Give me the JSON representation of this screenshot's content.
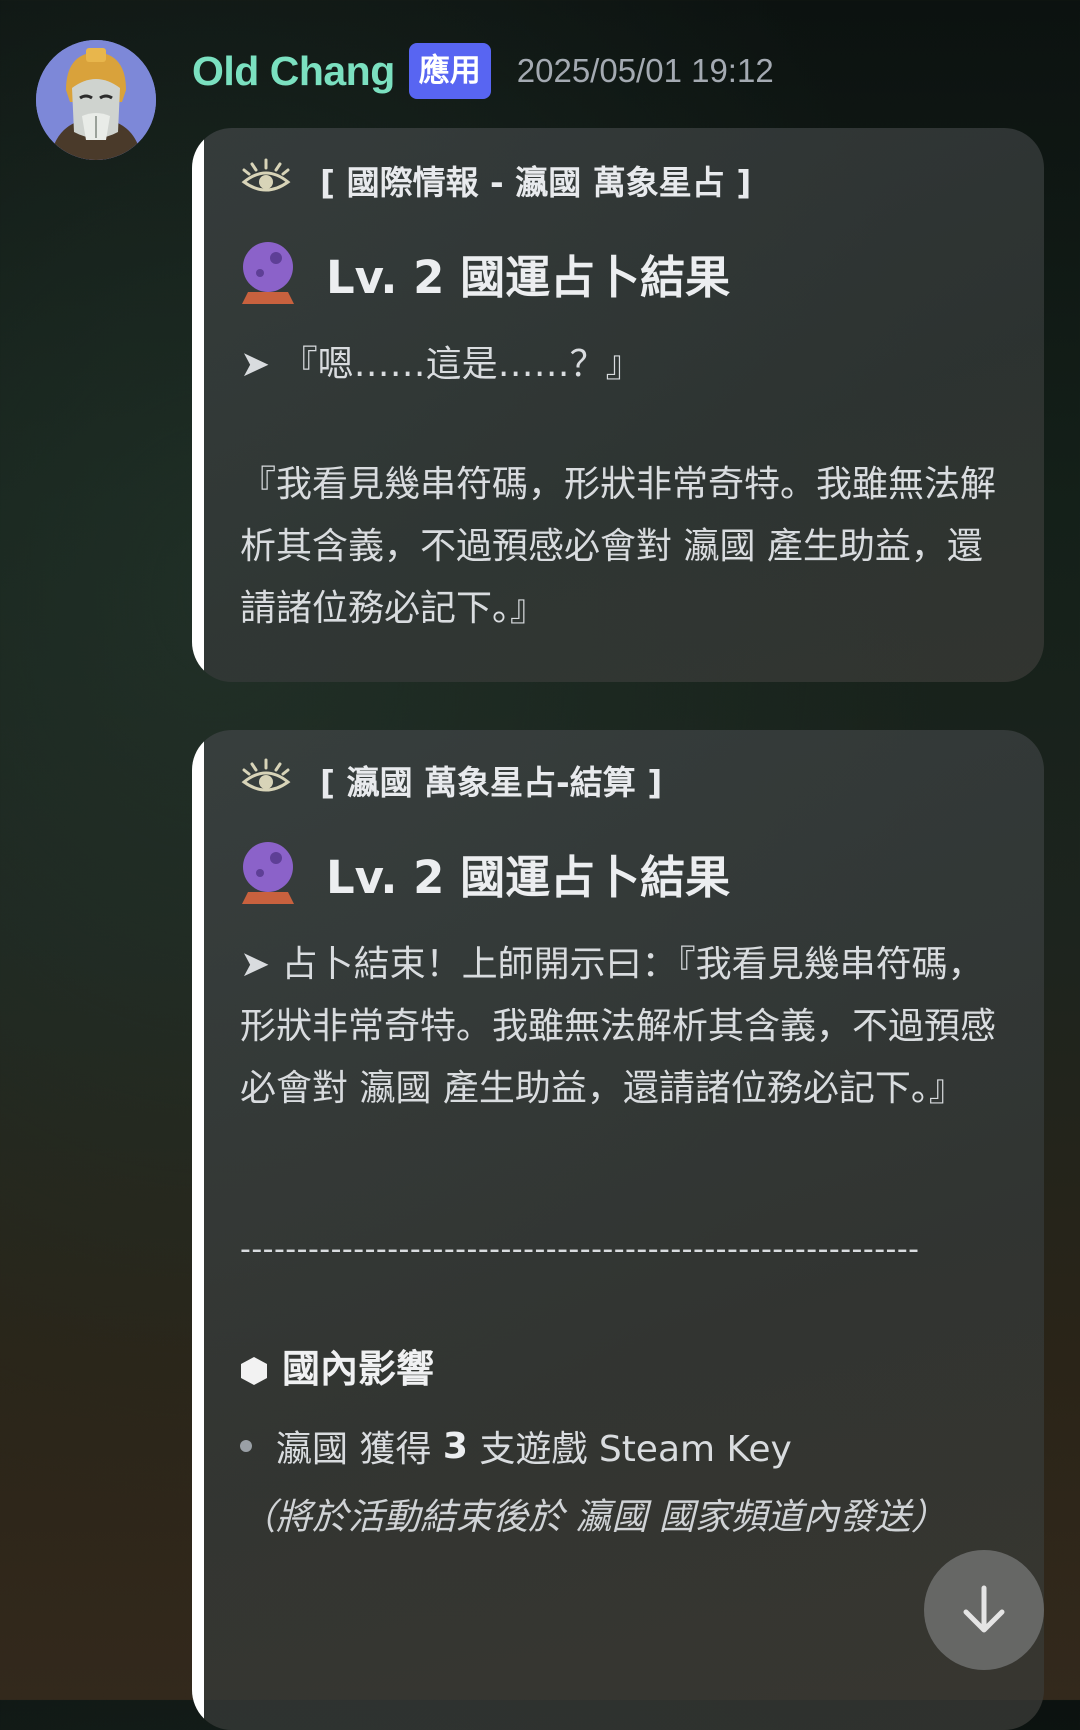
{
  "message": {
    "username": "Old Chang",
    "badge": "應用",
    "timestamp": "2025/05/01 19:12"
  },
  "embeds": [
    {
      "author": "[ 國際情報 - 瀛國 萬象星占 ]",
      "title": "Lv. 2 國運占卜結果",
      "lines": [
        "➤ 『嗯……這是……？』",
        "",
        "『我看見幾串符碼，形狀非常奇特。我雖無法解析其含義，不過預感必會對 瀛國 產生助益，還請諸位務必記下。』"
      ]
    },
    {
      "author": "[ 瀛國 萬象星占-結算 ]",
      "title": "Lv. 2 國運占卜結果",
      "description": "➤ 占卜結束！上師開示曰：『我看見幾串符碼，形狀非常奇特。我雖無法解析其含義，不過預感必會對 瀛國 產生助益，還請諸位務必記下。』",
      "divider": "------------------------------------------------------------",
      "section_title": "國內影響",
      "bullet_prefix": "瀛國 獲得 ",
      "bullet_count": "3",
      "bullet_suffix": " 支遊戲 Steam Key",
      "note": "（將於活動結束後於 瀛國 國家頻道內發送）"
    }
  ],
  "icons": {
    "author_icon": "eye-icon",
    "title_icon": "crystal-ball-icon",
    "section_icon": "hexagon-icon",
    "scroll_icon": "arrow-down-icon"
  },
  "colors": {
    "username": "#7be0c0",
    "badge_bg": "#5865f2",
    "embed_bar": "#ffffff"
  }
}
